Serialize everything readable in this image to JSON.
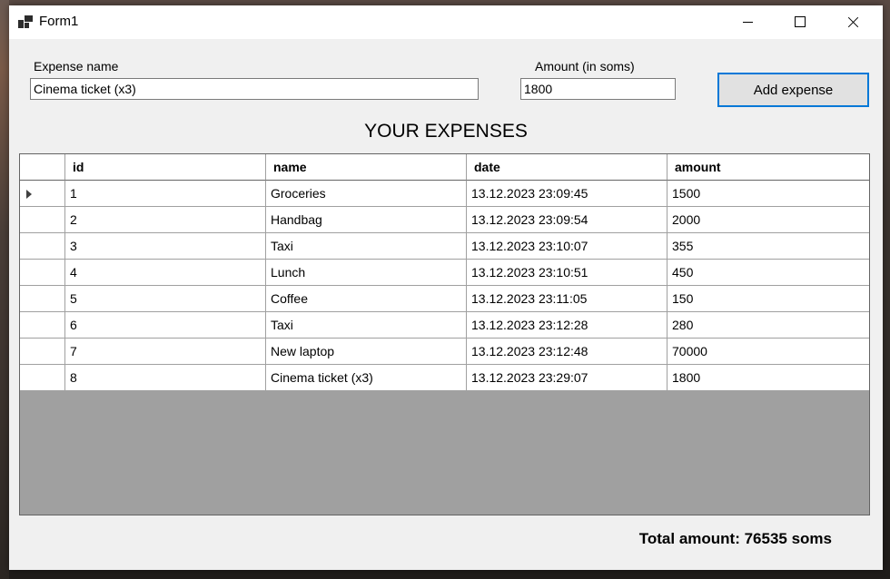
{
  "window": {
    "title": "Form1"
  },
  "form": {
    "expense_name_label": "Expense name",
    "expense_name_value": "Cinema ticket (x3)",
    "amount_label": "Amount (in soms)",
    "amount_value": "1800",
    "add_button_label": "Add expense"
  },
  "table": {
    "heading": "YOUR EXPENSES",
    "columns": [
      "id",
      "name",
      "date",
      "amount"
    ],
    "rows": [
      [
        "1",
        "Groceries",
        "13.12.2023 23:09:45",
        "1500"
      ],
      [
        "2",
        "Handbag",
        "13.12.2023 23:09:54",
        "2000"
      ],
      [
        "3",
        "Taxi",
        "13.12.2023 23:10:07",
        "355"
      ],
      [
        "4",
        "Lunch",
        "13.12.2023 23:10:51",
        "450"
      ],
      [
        "5",
        "Coffee",
        "13.12.2023 23:11:05",
        "150"
      ],
      [
        "6",
        "Taxi",
        "13.12.2023 23:12:28",
        "280"
      ],
      [
        "7",
        "New laptop",
        "13.12.2023 23:12:48",
        "70000"
      ],
      [
        "8",
        "Cinema ticket (x3)",
        "13.12.2023 23:29:07",
        "1800"
      ]
    ],
    "current_row_index": 0
  },
  "summary": {
    "total_text": "Total amount: 76535 soms"
  },
  "colors": {
    "accent": "#0078d7",
    "grid_background": "#a0a0a0"
  },
  "icons": {
    "app": "form-app-icon",
    "row_indicator": "current-row-arrow-icon"
  }
}
